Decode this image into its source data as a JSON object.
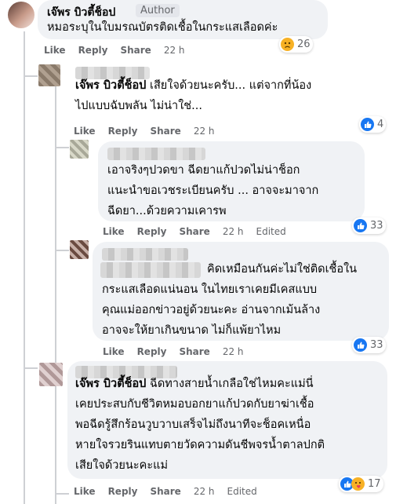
{
  "comments": [
    {
      "author": "เจ๊พร บิวตี้ช็อป",
      "badge": "Author",
      "lines": [
        "หมอระบุในใบมรณบัตรติดเชื้อในกระแสเลือดค่ะ"
      ],
      "actions": {
        "like": "Like",
        "reply": "Reply",
        "share": "Share",
        "time": "22 h"
      },
      "reactions": {
        "icons": [
          "sad-icon"
        ],
        "count": "26"
      }
    },
    {
      "author": "",
      "tag": "เจ๊พร บิวตี้ช็อป",
      "lines": [
        " เสียใจด้วยนะครับ... แต่จากที่น้อง",
        "ไปแบบฉับพลัน ไม่น่าใช่..."
      ],
      "actions": {
        "like": "Like",
        "reply": "Reply",
        "share": "Share",
        "time": "22 h"
      },
      "reactions": {
        "icons": [
          "like-icon"
        ],
        "count": "4"
      }
    },
    {
      "author": "",
      "lines": [
        "เอาจริงๆปวดขา ฉีดยาแก้ปวดไม่น่าช็อก",
        "แนะนำขอเวชระเบียนครับ ... อาจจะมาจาก",
        "ฉีดยา...ด้วยความเคารพ"
      ],
      "actions": {
        "like": "Like",
        "reply": "Reply",
        "share": "Share",
        "time": "22 h",
        "edited": "Edited"
      },
      "reactions": {
        "icons": [
          "like-icon"
        ],
        "count": "33"
      }
    },
    {
      "author": "",
      "lines": [
        "คิดเหมือนกันค่ะไม่ใช่ติดเชื้อใน",
        "กระแสเลือดแน่นอน ในไทยเราเคยมีเคสแบบ",
        "คุณแม่ออกข่าวอยู่ด้วยนะคะ อ่านจากเม้นล้าง",
        "อาจจะให้ยาเกินขนาด ไม่ก็แพ้ยาไหม"
      ],
      "actions": {
        "like": "Like",
        "reply": "Reply",
        "share": "Share",
        "time": "22 h"
      },
      "reactions": {
        "icons": [
          "like-icon"
        ],
        "count": "33"
      }
    },
    {
      "author": "",
      "tag": "เจ๊พร บิวตี้ช็อป",
      "lines": [
        " ฉีดทางสายน้ำเกลือใช่ไหมคะแม่นี่",
        "เคยประสบกับชีวิตหมอบอกยาแก้ปวดกับยาฆ่าเชื้อ",
        "พอฉีดรู้สึกร้อนวูบวาบเสร็จไม่ถึงนาทีจะช็อคเหนื่อ",
        "หายใจรวยรินแทบตายวัดความดันชีพจรน้ำตาลปกติ",
        "เสียใจด้วยนะคะแม่"
      ],
      "actions": {
        "like": "Like",
        "reply": "Reply",
        "share": "Share",
        "time": "22 h",
        "edited": "Edited"
      },
      "reactions": {
        "icons": [
          "like-icon",
          "care-icon"
        ],
        "count": "17"
      }
    }
  ]
}
